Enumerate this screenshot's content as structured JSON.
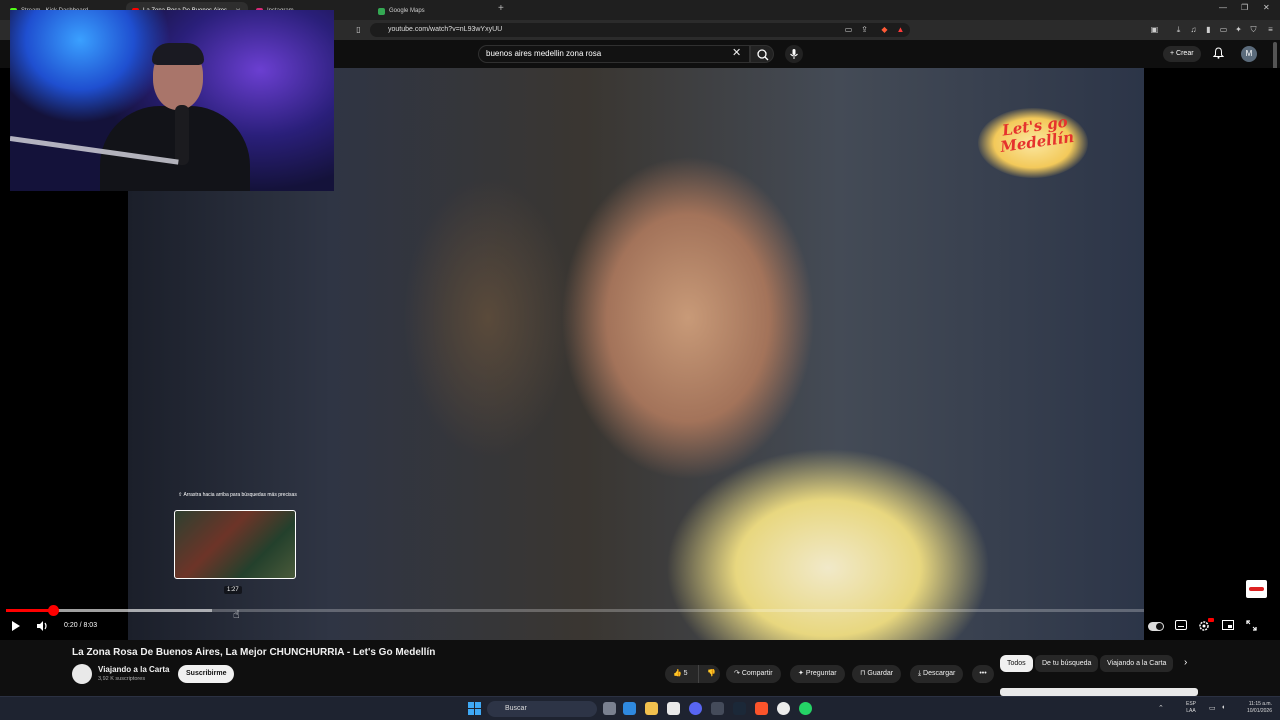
{
  "browser": {
    "tabs": [
      {
        "label": "Stream - Kick Dashboard",
        "color": "#53fc18",
        "active": false
      },
      {
        "label": "La Zona Rosa De Buenos Aires",
        "color": "#ff0000",
        "active": true
      },
      {
        "label": "Instagram",
        "color": "#d62976",
        "active": false
      },
      {
        "label": "Google Maps",
        "color": "#34a853",
        "active": false
      }
    ],
    "new_tab": "+",
    "url": "youtube.com/watch?v=nL93wYxyUU"
  },
  "youtube": {
    "search_query": "buenos aires medellin zona rosa",
    "create_label": "Crear",
    "avatar_letter": "M"
  },
  "player": {
    "overlay_logo_text": "Let's go Medellín",
    "drag_hint": "⇧ Arrastra hacia arriba para búsquedas más precisas",
    "preview_time": "1:27",
    "current_time": "0:20 / 8:03",
    "progress_fraction": 0.0414,
    "hover_fraction": 0.1807
  },
  "video": {
    "title": "La Zona Rosa De Buenos Aires, La Mejor CHUNCHURRIA - Let's Go Medellín",
    "channel": "Viajando a la Carta",
    "subscribers": "3,92 K suscriptores",
    "subscribe_label": "Suscribirme",
    "likes": "5",
    "share_label": "Compartir",
    "ask_label": "Preguntar",
    "save_label": "Guardar",
    "download_label": "Descargar",
    "more_label": "•••"
  },
  "chips": [
    "Todos",
    "De tu búsqueda",
    "Viajando a la Carta"
  ],
  "taskbar": {
    "search_label": "Buscar",
    "lang_line1": "ESP",
    "lang_line2": "LAA",
    "time": "11:15 a.m.",
    "date": "10/01/2026"
  },
  "icons": {
    "play": "▶",
    "volume": "🔊",
    "search": "⌕",
    "bell": "🔔",
    "close": "✕",
    "mic": "🎙",
    "like": "👍",
    "dislike": "👎"
  },
  "colors": {
    "accent": "#ff0000",
    "background": "#0f0f0f",
    "chip_selected": "#f1f1f1"
  }
}
